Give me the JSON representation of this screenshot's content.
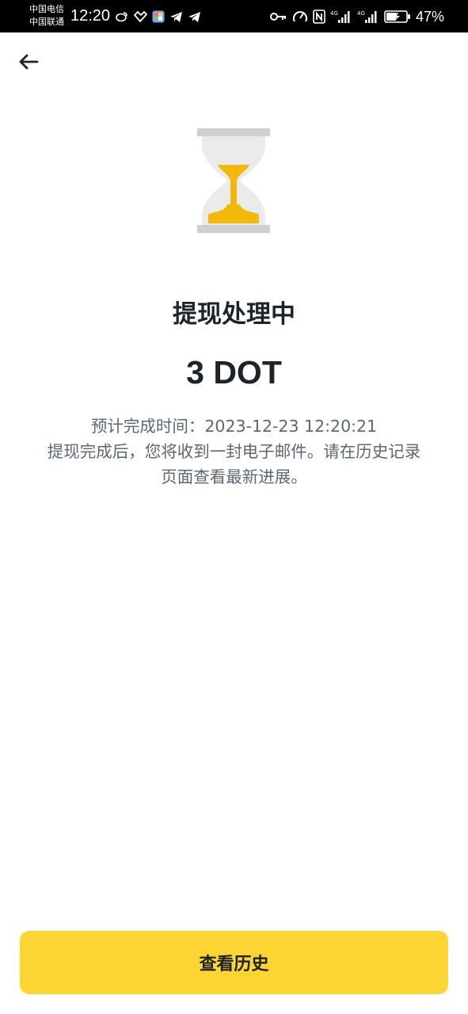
{
  "status_bar": {
    "carrier_1": "中国电信",
    "carrier_2": "中国联通",
    "time": "12:20",
    "battery": "47%",
    "left_icons": [
      "weibo-icon",
      "app-icon",
      "colorful-app-icon",
      "telegram-icon",
      "telegram-icon"
    ],
    "right_icons": [
      "key-icon",
      "speed-icon",
      "nfc-icon",
      "signal-4g-icon",
      "signal-4g-icon",
      "battery-icon"
    ]
  },
  "nav": {
    "back_icon": "arrow-left-icon"
  },
  "main": {
    "status_icon": "hourglass-icon",
    "title": "提现处理中",
    "amount": "3 DOT",
    "estimated_label": "预计完成时间：",
    "estimated_time": "2023-12-23 12:20:21",
    "notice_line1": "提现完成后，您将收到一封电子邮件。请在历史记录",
    "notice_line2": "页面查看最新进展。"
  },
  "footer": {
    "history_button": "查看历史"
  },
  "colors": {
    "accent": "#fcd535",
    "hourglass_sand": "#f0b90b",
    "text_primary": "#1e2329",
    "text_secondary": "#5e6673"
  }
}
